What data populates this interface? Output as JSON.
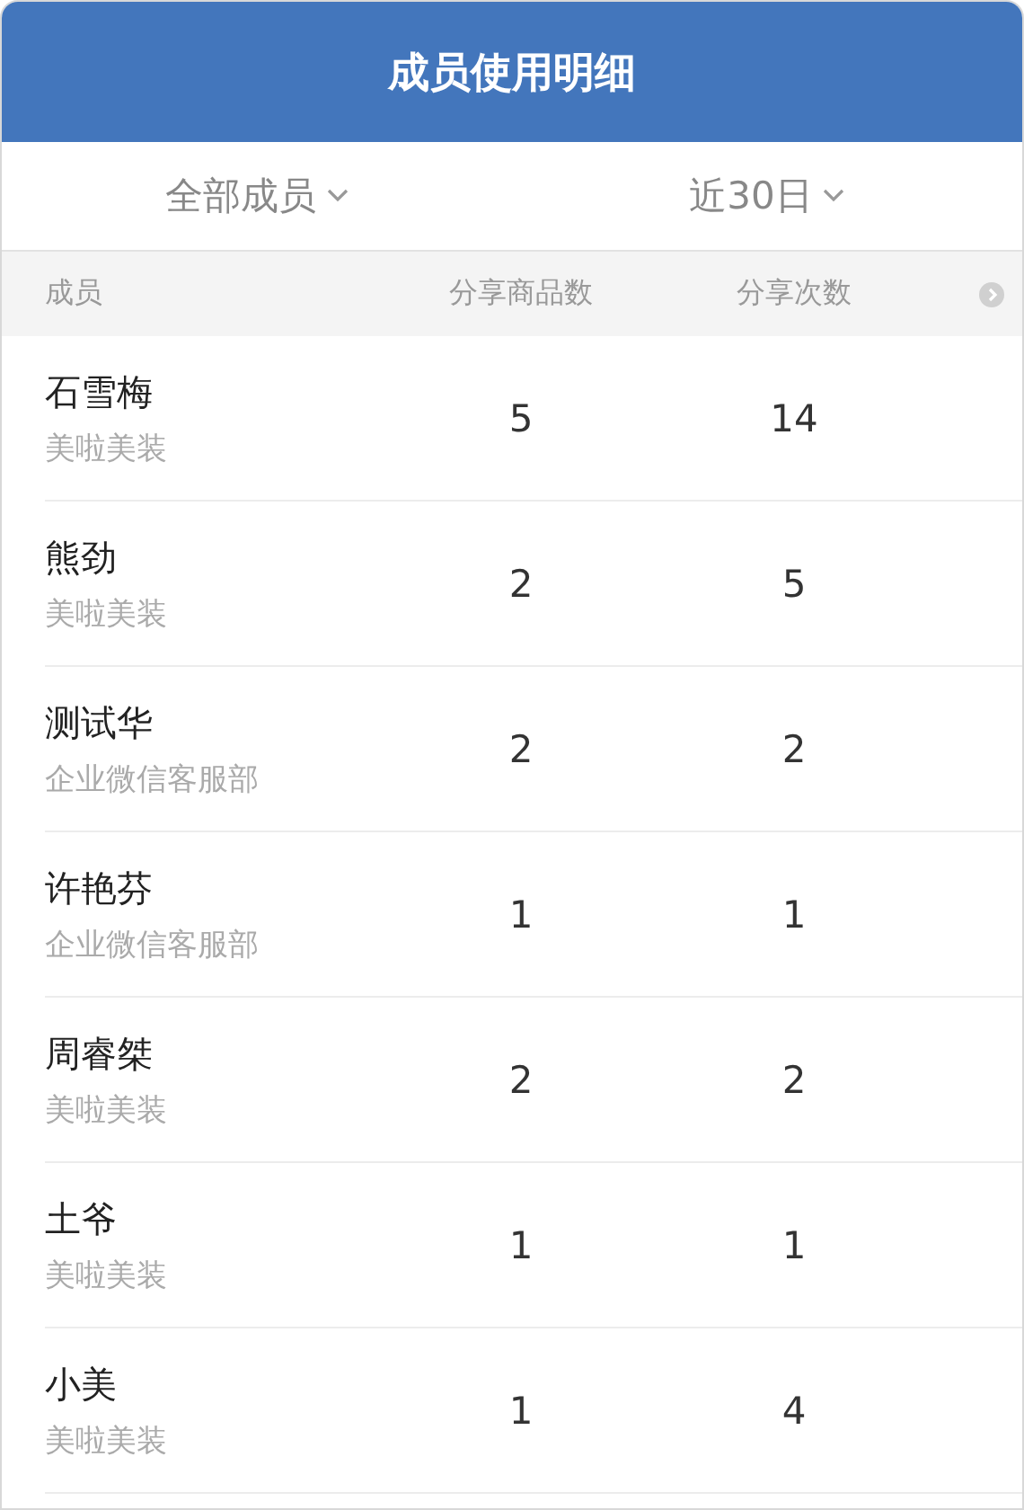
{
  "title": "成员使用明细",
  "filters": [
    {
      "label": "全部成员"
    },
    {
      "label": "近30日"
    }
  ],
  "columns": [
    "成员",
    "分享商品数",
    "分享次数"
  ],
  "rows": [
    {
      "name": "石雪梅",
      "dept": "美啦美装",
      "items": "5",
      "shares": "14"
    },
    {
      "name": "熊劲",
      "dept": "美啦美装",
      "items": "2",
      "shares": "5"
    },
    {
      "name": "测试华",
      "dept": "企业微信客服部",
      "items": "2",
      "shares": "2"
    },
    {
      "name": "许艳芬",
      "dept": "企业微信客服部",
      "items": "1",
      "shares": "1"
    },
    {
      "name": "周睿桀",
      "dept": "美啦美装",
      "items": "2",
      "shares": "2"
    },
    {
      "name": "土爷",
      "dept": "美啦美装",
      "items": "1",
      "shares": "1"
    },
    {
      "name": "小美",
      "dept": "美啦美装",
      "items": "1",
      "shares": "4"
    }
  ]
}
